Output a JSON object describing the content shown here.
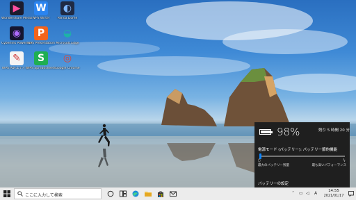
{
  "desktop": {
    "icons": [
      {
        "label": "Wondershare Media Cutter",
        "name": "wondershare-media-cutter-icon",
        "color": "#1c1c2e",
        "glyph": "▶",
        "glyphColor": "#ff4fa0"
      },
      {
        "label": "WPS Writer",
        "name": "wps-writer-icon",
        "color": "#2b84ef",
        "glyph": "W",
        "glyphColor": "#ffffff"
      },
      {
        "label": "Panda Dome",
        "name": "panda-dome-icon",
        "color": "#1f2a44",
        "glyph": "◐",
        "glyphColor": "#7fb8ff"
      },
      {
        "label": "Cyberlink PowerDVD",
        "name": "cyberlink-powerdvd-icon",
        "color": "#151530",
        "glyph": "◉",
        "glyphColor": "#b06bff"
      },
      {
        "label": "WPS Presentation",
        "name": "wps-presentation-icon",
        "color": "#f2641c",
        "glyph": "P",
        "glyphColor": "#ffffff"
      },
      {
        "label": "Microsoft Edge",
        "name": "microsoft-edge-icon",
        "color": "transparent",
        "glyph": "◒",
        "glyphColor": "#1db3a6"
      },
      {
        "label": "WPS PDFエディター",
        "name": "wps-pdf-editor-icon",
        "color": "#f4f4f4",
        "glyph": "✎",
        "glyphColor": "#d03535"
      },
      {
        "label": "WPS Spreadsheets",
        "name": "wps-spreadsheets-icon",
        "color": "#1fae52",
        "glyph": "S",
        "glyphColor": "#ffffff"
      },
      {
        "label": "Google Chrome",
        "name": "google-chrome-icon",
        "color": "transparent",
        "glyph": "◎",
        "glyphColor": "#db4437"
      }
    ]
  },
  "battery": {
    "percent_text": "98%",
    "percent_value": 98,
    "remaining": "残り 5 時間 20 分",
    "mode_label": "電源モード (バッテリー): バッテリー節約機能",
    "slider_value": 0,
    "left_label": "最大のバッテリー残量",
    "right_label": "最も高いパフォーマンス",
    "settings_link": "バッテリーの設定"
  },
  "taskbar": {
    "search_placeholder": "ここに入力して検索",
    "pinned": [
      "task-view",
      "widgets",
      "microsoft-edge",
      "file-explorer",
      "microsoft-store",
      "mail"
    ],
    "tray": {
      "ime_mode": "A",
      "time": "14:55",
      "date": "2021/01/17"
    }
  },
  "colors": {
    "flyout_bg": "#1f1f1f",
    "accent": "#0a84ff",
    "taskbar_bg": "#ececec"
  }
}
